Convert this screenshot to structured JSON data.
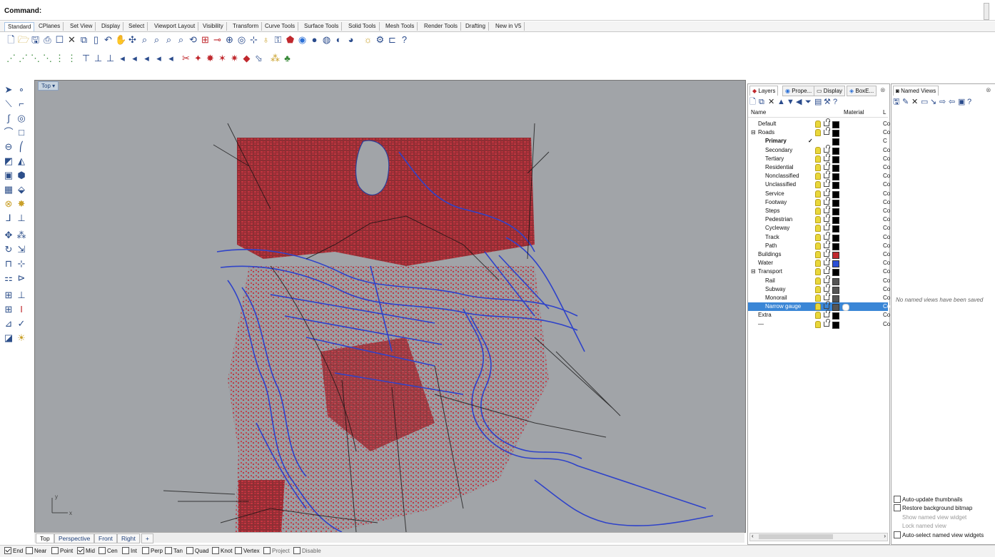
{
  "command_bar": {
    "label": "Command:"
  },
  "toolbar_tabs": [
    "Standard",
    "CPlanes",
    "Set View",
    "Display",
    "Select",
    "Viewport Layout",
    "Visibility",
    "Transform",
    "Curve Tools",
    "Surface Tools",
    "Solid Tools",
    "Mesh Tools",
    "Render Tools",
    "Drafting",
    "New in V5"
  ],
  "viewport": {
    "title": "Top",
    "axis_x": "x",
    "axis_y": "y"
  },
  "viewport_tabs": [
    "Top",
    "Perspective",
    "Front",
    "Right",
    "+"
  ],
  "osnaps": [
    {
      "label": "End",
      "checked": true
    },
    {
      "label": "Near",
      "checked": false
    },
    {
      "label": "Point",
      "checked": false
    },
    {
      "label": "Mid",
      "checked": true
    },
    {
      "label": "Cen",
      "checked": false
    },
    {
      "label": "Int",
      "checked": false
    },
    {
      "label": "Perp",
      "checked": false
    },
    {
      "label": "Tan",
      "checked": false
    },
    {
      "label": "Quad",
      "checked": false
    },
    {
      "label": "Knot",
      "checked": false
    },
    {
      "label": "Vertex",
      "checked": false
    },
    {
      "label": "Project",
      "checked": false
    },
    {
      "label": "Disable",
      "checked": false
    }
  ],
  "layers_panel": {
    "tabs": [
      "Layers",
      "Prope...",
      "Display",
      "BoxE..."
    ],
    "col_name": "Name",
    "col_material": "Material",
    "col_linetype": "L",
    "rows": [
      {
        "name": "Default",
        "indent": 0,
        "color": "#000000",
        "check": false,
        "bold": false,
        "expander": "",
        "selected": false,
        "cut": "Co"
      },
      {
        "name": "Roads",
        "indent": 0,
        "color": "#000000",
        "check": false,
        "bold": false,
        "expander": "⊟",
        "selected": false,
        "cut": "Co"
      },
      {
        "name": "Primary",
        "indent": 1,
        "color": "#000000",
        "check": true,
        "bold": true,
        "expander": "",
        "selected": false,
        "cut": "C"
      },
      {
        "name": "Secondary",
        "indent": 1,
        "color": "#000000",
        "check": false,
        "bold": false,
        "expander": "",
        "selected": false,
        "cut": "Co"
      },
      {
        "name": "Tertiary",
        "indent": 1,
        "color": "#000000",
        "check": false,
        "bold": false,
        "expander": "",
        "selected": false,
        "cut": "Co"
      },
      {
        "name": "Residential",
        "indent": 1,
        "color": "#000000",
        "check": false,
        "bold": false,
        "expander": "",
        "selected": false,
        "cut": "Co"
      },
      {
        "name": "Nonclassified",
        "indent": 1,
        "color": "#000000",
        "check": false,
        "bold": false,
        "expander": "",
        "selected": false,
        "cut": "Co"
      },
      {
        "name": "Unclassified",
        "indent": 1,
        "color": "#000000",
        "check": false,
        "bold": false,
        "expander": "",
        "selected": false,
        "cut": "Co"
      },
      {
        "name": "Service",
        "indent": 1,
        "color": "#000000",
        "check": false,
        "bold": false,
        "expander": "",
        "selected": false,
        "cut": "Co"
      },
      {
        "name": "Footway",
        "indent": 1,
        "color": "#000000",
        "check": false,
        "bold": false,
        "expander": "",
        "selected": false,
        "cut": "Co"
      },
      {
        "name": "Steps",
        "indent": 1,
        "color": "#000000",
        "check": false,
        "bold": false,
        "expander": "",
        "selected": false,
        "cut": "Co"
      },
      {
        "name": "Pedestrian",
        "indent": 1,
        "color": "#000000",
        "check": false,
        "bold": false,
        "expander": "",
        "selected": false,
        "cut": "Co"
      },
      {
        "name": "Cycleway",
        "indent": 1,
        "color": "#000000",
        "check": false,
        "bold": false,
        "expander": "",
        "selected": false,
        "cut": "Co"
      },
      {
        "name": "Track",
        "indent": 1,
        "color": "#000000",
        "check": false,
        "bold": false,
        "expander": "",
        "selected": false,
        "cut": "Co"
      },
      {
        "name": "Path",
        "indent": 1,
        "color": "#000000",
        "check": false,
        "bold": false,
        "expander": "",
        "selected": false,
        "cut": "Co"
      },
      {
        "name": "Buildings",
        "indent": 0,
        "color": "#c0282d",
        "check": false,
        "bold": false,
        "expander": "",
        "selected": false,
        "cut": "Co"
      },
      {
        "name": "Water",
        "indent": 0,
        "color": "#2a4fd6",
        "check": false,
        "bold": false,
        "expander": "",
        "selected": false,
        "cut": "Co"
      },
      {
        "name": "Transport",
        "indent": 0,
        "color": "#000000",
        "check": false,
        "bold": false,
        "expander": "⊟",
        "selected": false,
        "cut": "Co"
      },
      {
        "name": "Rail",
        "indent": 1,
        "color": "#555555",
        "check": false,
        "bold": false,
        "expander": "",
        "selected": false,
        "cut": "Co"
      },
      {
        "name": "Subway",
        "indent": 1,
        "color": "#555555",
        "check": false,
        "bold": false,
        "expander": "",
        "selected": false,
        "cut": "Co"
      },
      {
        "name": "Monorail",
        "indent": 1,
        "color": "#555555",
        "check": false,
        "bold": false,
        "expander": "",
        "selected": false,
        "cut": "Co"
      },
      {
        "name": "Narrow gauge",
        "indent": 1,
        "color": "#555555",
        "check": false,
        "bold": false,
        "expander": "",
        "selected": true,
        "cut": "Co"
      },
      {
        "name": "Extra",
        "indent": 0,
        "color": "#000000",
        "check": false,
        "bold": false,
        "expander": "",
        "selected": false,
        "cut": "Co"
      },
      {
        "name": "—",
        "indent": 0,
        "color": "#000000",
        "check": false,
        "bold": false,
        "expander": "",
        "selected": false,
        "cut": "Co"
      }
    ]
  },
  "named_views": {
    "tab": "Named Views",
    "empty_message": "No named views have been saved",
    "options": [
      {
        "label": "Auto-update thumbnails",
        "checkbox": true,
        "enabled": true
      },
      {
        "label": "Restore background bitmap",
        "checkbox": true,
        "enabled": true
      },
      {
        "label": "Show named view widget",
        "checkbox": false,
        "enabled": false
      },
      {
        "label": "Lock named view",
        "checkbox": false,
        "enabled": false
      },
      {
        "label": "Auto-select named view widgets",
        "checkbox": true,
        "enabled": true
      }
    ]
  },
  "colors": {
    "viewport_bg": "#a1a4a8",
    "buildings": "#c0282d",
    "water": "#2a4fd6",
    "roads": "#111111",
    "selection": "#3a86d6"
  }
}
